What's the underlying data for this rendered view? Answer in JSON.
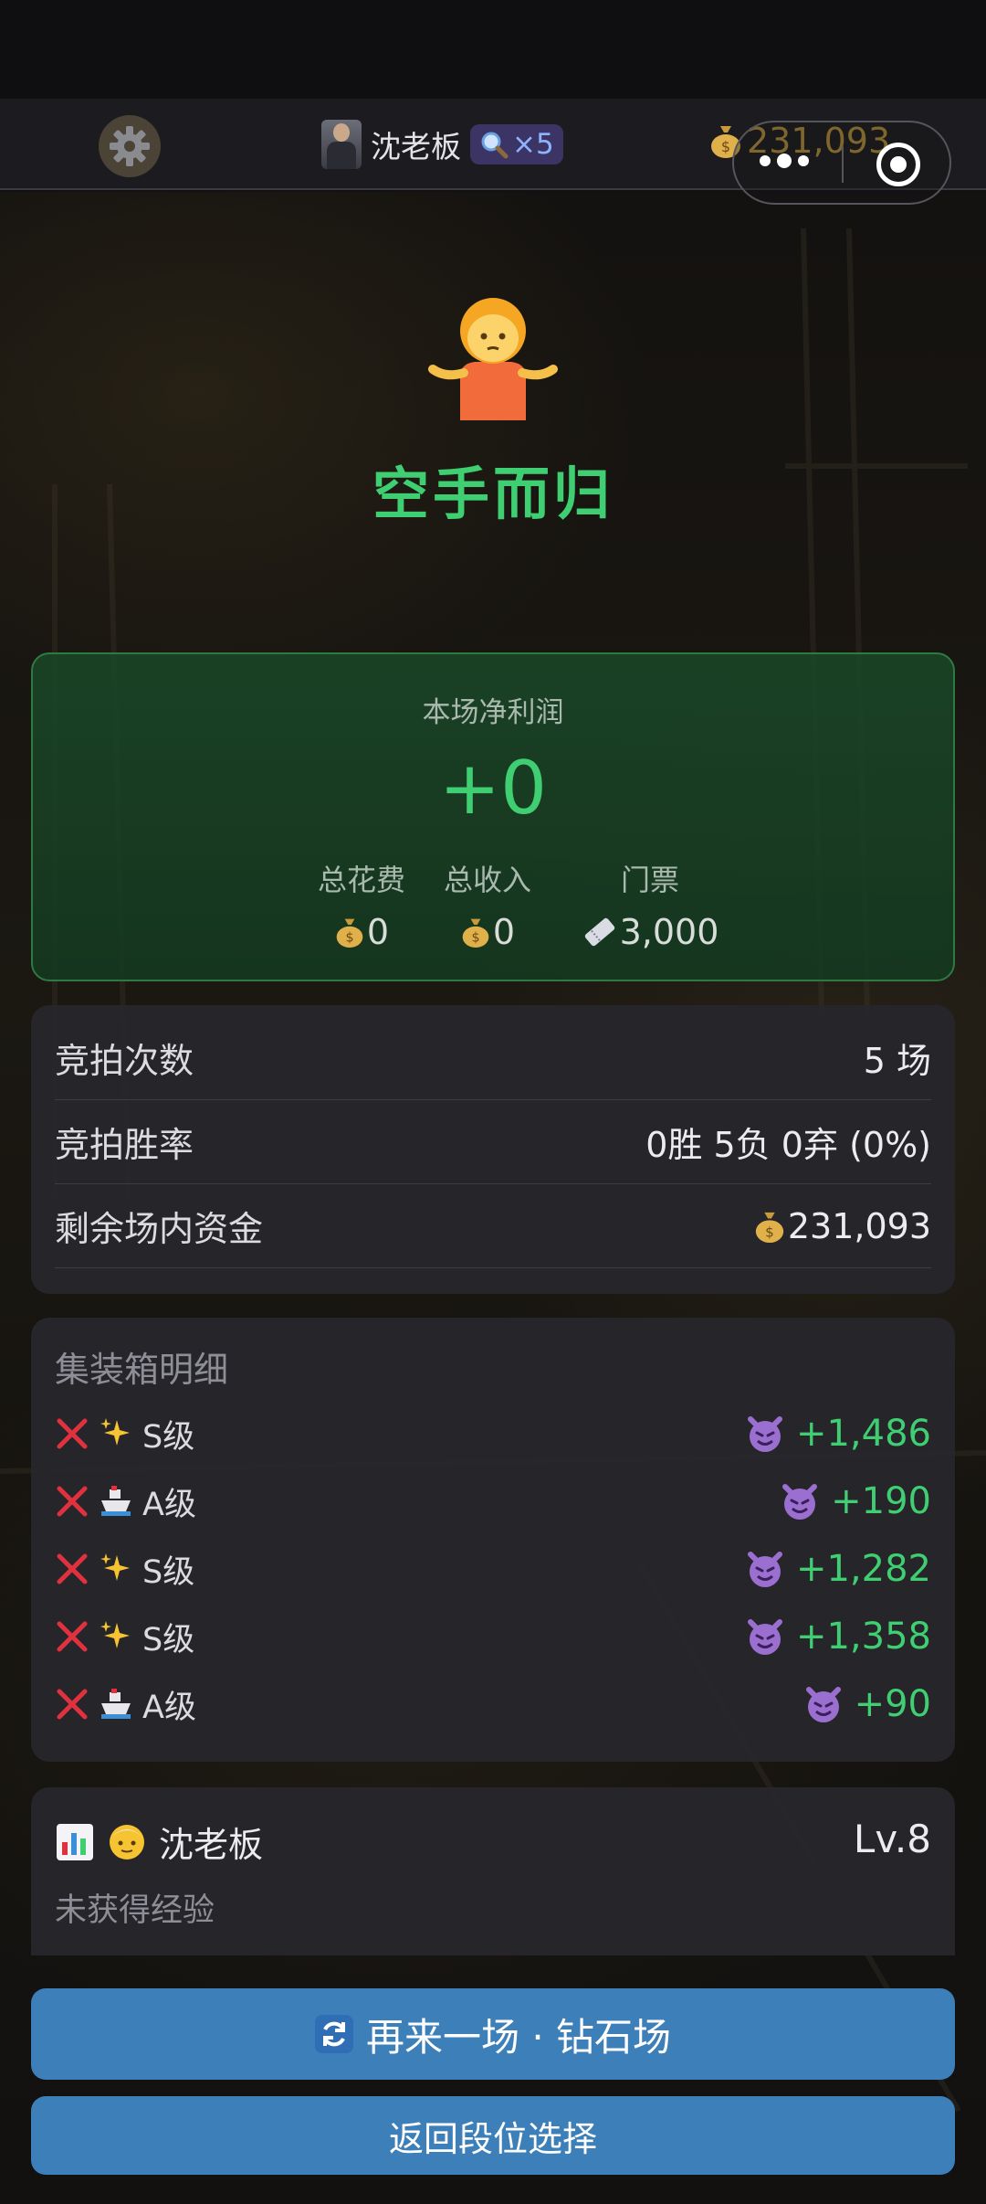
{
  "top_bar": {
    "player_name": "沈老板",
    "boost_count": "×5",
    "coins": "231,093"
  },
  "result": {
    "title": "空手而归"
  },
  "profit": {
    "label": "本场净利润",
    "value": "+0",
    "spent_label": "总花费",
    "spent_value": "0",
    "income_label": "总收入",
    "income_value": "0",
    "ticket_label": "门票",
    "ticket_value": "3,000"
  },
  "stats": {
    "rows": [
      {
        "label": "竞拍次数",
        "value": "5 场"
      },
      {
        "label": "竞拍胜率",
        "value": "0胜 5负 0弃 (0%)"
      },
      {
        "label": "剩余场内资金",
        "value": "231,093"
      }
    ]
  },
  "containers": {
    "title": "集装箱明细",
    "items": [
      {
        "icon": "sparkles-icon",
        "grade": "S级",
        "amount": "+1,486"
      },
      {
        "icon": "ship-icon",
        "grade": "A级",
        "amount": "+190"
      },
      {
        "icon": "sparkles-icon",
        "grade": "S级",
        "amount": "+1,282"
      },
      {
        "icon": "sparkles-icon",
        "grade": "S级",
        "amount": "+1,358"
      },
      {
        "icon": "ship-icon",
        "grade": "A级",
        "amount": "+90"
      }
    ]
  },
  "player_card": {
    "name": "沈老板",
    "level": "Lv.8",
    "exp_text": "未获得经验"
  },
  "buttons": {
    "play_again": "再来一场 · 钻石场",
    "back": "返回段位选择"
  },
  "colors": {
    "profit_green": "#3fcf72",
    "button_blue": "#3d7fb8",
    "coin_gold": "#b8923a"
  }
}
